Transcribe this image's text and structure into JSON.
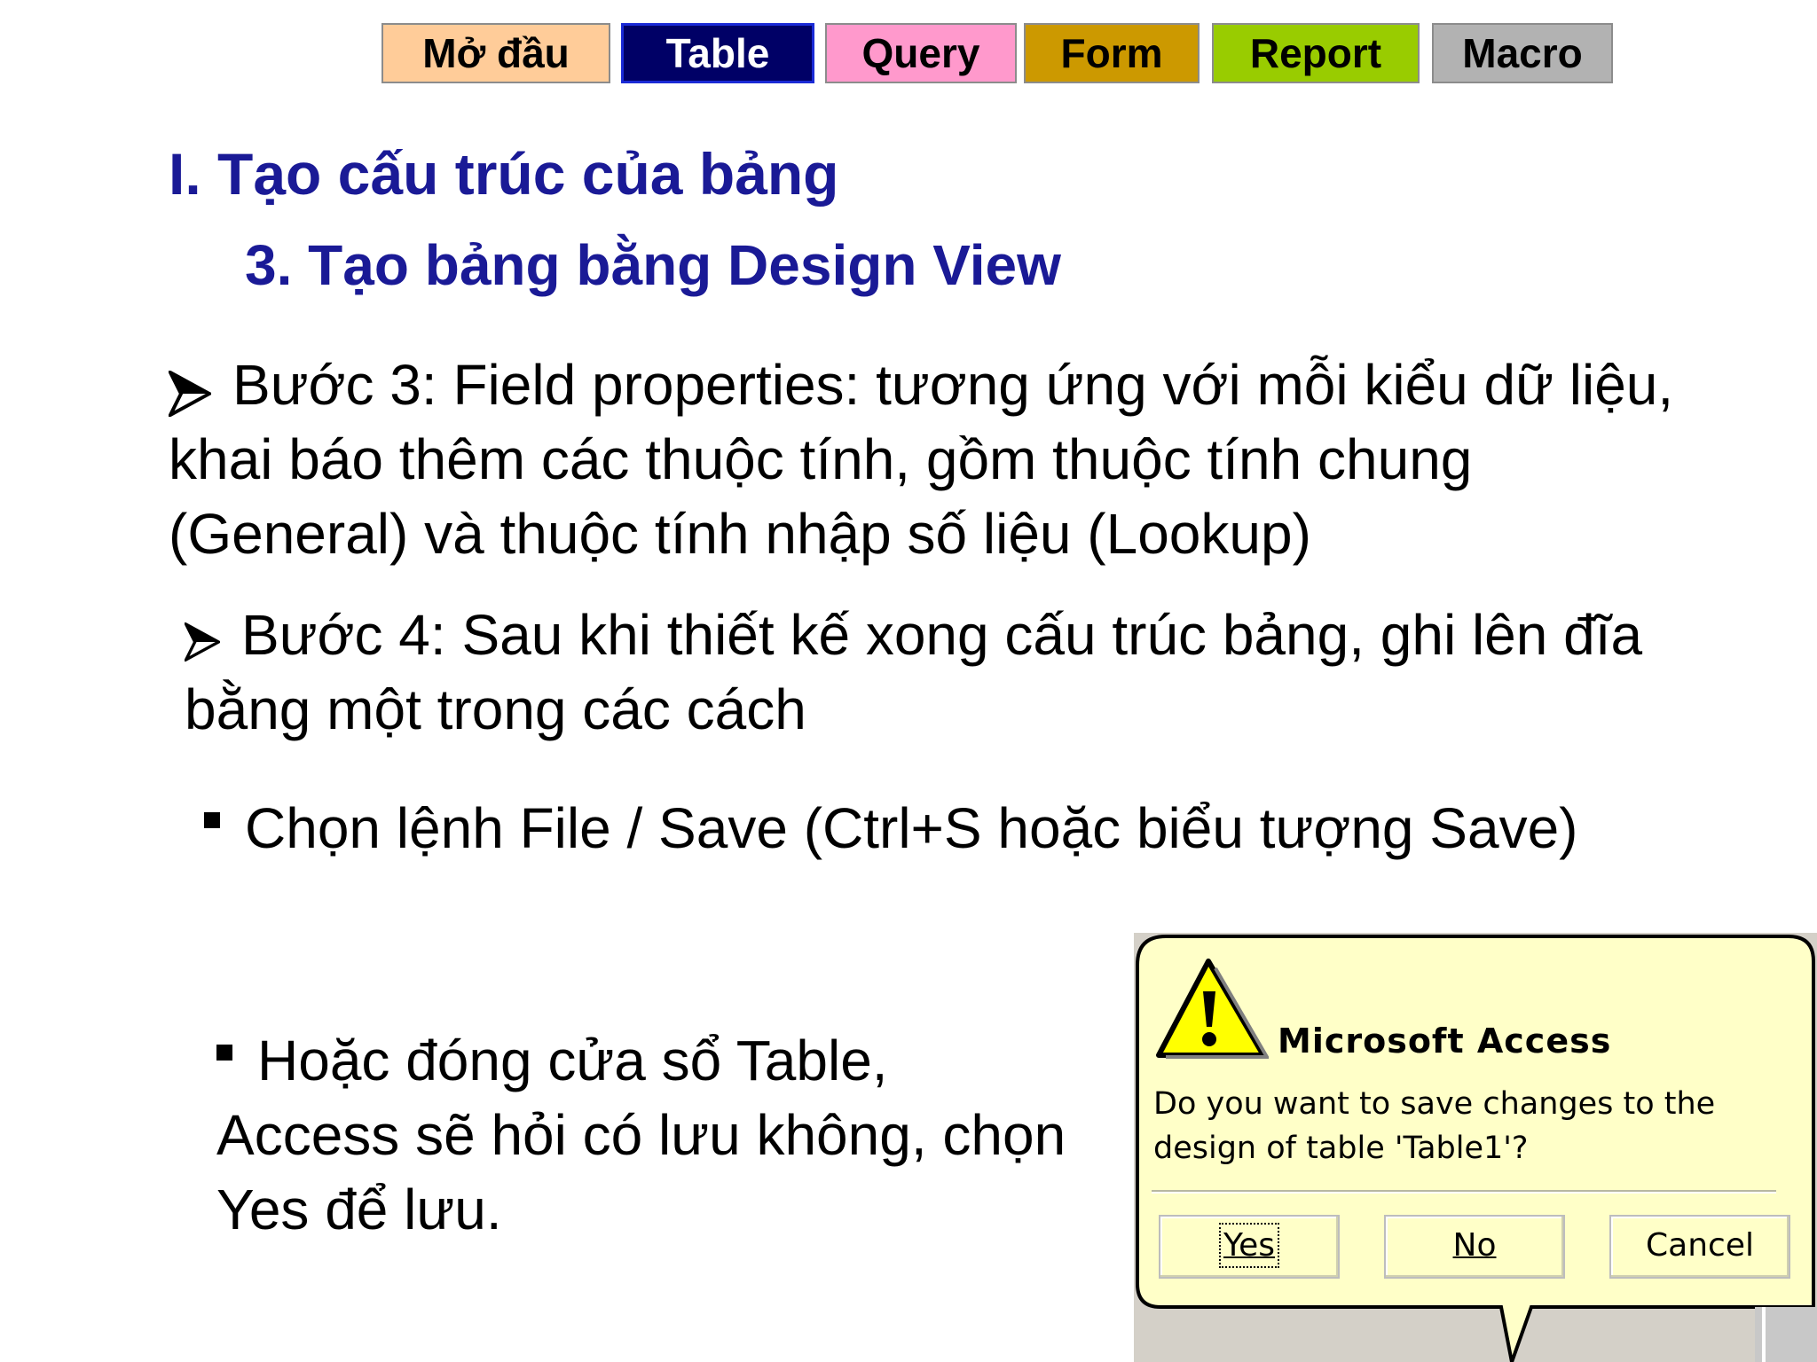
{
  "nav": {
    "items": [
      {
        "label": "Mở đầu",
        "color": "#ffcc99"
      },
      {
        "label": "Table",
        "color": "#000066",
        "active": true
      },
      {
        "label": "Query",
        "color": "#ff99cc"
      },
      {
        "label": "Form",
        "color": "#cc9900"
      },
      {
        "label": "Report",
        "color": "#99cc00"
      },
      {
        "label": "Macro",
        "color": "#b2b2b2"
      }
    ]
  },
  "heading": {
    "section": "I. Tạo cấu trúc của bảng",
    "subsection": "3. Tạo bảng bằng Design View"
  },
  "step3": {
    "line1": "Bước 3: Field properties: tương ứng với mỗi kiểu dữ liệu,",
    "line2": "khai báo thêm các thuộc tính, gồm thuộc tính chung",
    "line3": "(General) và thuộc tính nhập số liệu (Lookup)"
  },
  "step4": {
    "line1": "Bước 4: Sau khi thiết kế xong cấu trúc bảng, ghi lên đĩa",
    "line2": "bằng một trong các cách"
  },
  "bullets": {
    "save_cmd": "Chọn lệnh File / Save (Ctrl+S hoặc biểu tượng Save)",
    "close_line1": "Hoặc đóng cửa sổ Table,",
    "close_line2": "Access sẽ hỏi có lưu không, chọn",
    "close_line3": "Yes để lưu."
  },
  "dialog": {
    "title": "Microsoft Access",
    "message_line1": "Do you want to save changes to the",
    "message_line2": "design of table 'Table1'?",
    "buttons": {
      "yes": "Yes",
      "no": "No",
      "cancel": "Cancel"
    },
    "icon": "warning-icon",
    "background_color": "#ffffc8"
  }
}
